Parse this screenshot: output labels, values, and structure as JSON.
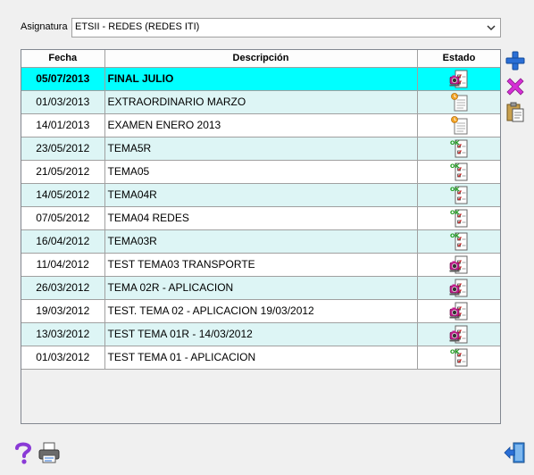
{
  "subject": {
    "label": "Asignatura",
    "value": "ETSII - REDES (REDES ITI)"
  },
  "table": {
    "columns": [
      "Fecha",
      "Descripción",
      "Estado"
    ],
    "selected_index": 0,
    "rows": [
      {
        "date": "05/07/2013",
        "description": "FINAL JULIO",
        "state": "camera-check-icon"
      },
      {
        "date": "01/03/2013",
        "description": "EXTRAORDINARIO MARZO",
        "state": "pending-document-icon"
      },
      {
        "date": "14/01/2013",
        "description": "EXAMEN ENERO 2013",
        "state": "pending-document-icon"
      },
      {
        "date": "23/05/2012",
        "description": "TEMA5R",
        "state": "ok-check-icon"
      },
      {
        "date": "21/05/2012",
        "description": "TEMA05",
        "state": "ok-check-icon"
      },
      {
        "date": "14/05/2012",
        "description": "TEMA04R",
        "state": "ok-check-icon"
      },
      {
        "date": "07/05/2012",
        "description": "TEMA04 REDES",
        "state": "ok-check-icon"
      },
      {
        "date": "16/04/2012",
        "description": "TEMA03R",
        "state": "ok-check-icon"
      },
      {
        "date": "11/04/2012",
        "description": "TEST TEMA03 TRANSPORTE",
        "state": "camera-check-icon"
      },
      {
        "date": "26/03/2012",
        "description": "TEMA 02R - APLICACION",
        "state": "camera-check-icon"
      },
      {
        "date": "19/03/2012",
        "description": "TEST. TEMA 02 - APLICACION 19/03/2012",
        "state": "camera-check-icon"
      },
      {
        "date": "13/03/2012",
        "description": "TEST TEMA 01R - 14/03/2012",
        "state": "camera-check-icon"
      },
      {
        "date": "01/03/2012",
        "description": "TEST TEMA 01 - APLICACION",
        "state": "ok-check-icon"
      }
    ]
  },
  "toolbar": {
    "side_icons": [
      "add-icon",
      "delete-icon",
      "paste-icon"
    ],
    "bottom_icons": [
      "help-icon",
      "print-icon",
      "exit-icon"
    ]
  },
  "colors": {
    "selected_row": "#00ffff",
    "alt_row": "#ddf5f5",
    "ok_green": "#1a9c1a",
    "check_red": "#d02020"
  }
}
